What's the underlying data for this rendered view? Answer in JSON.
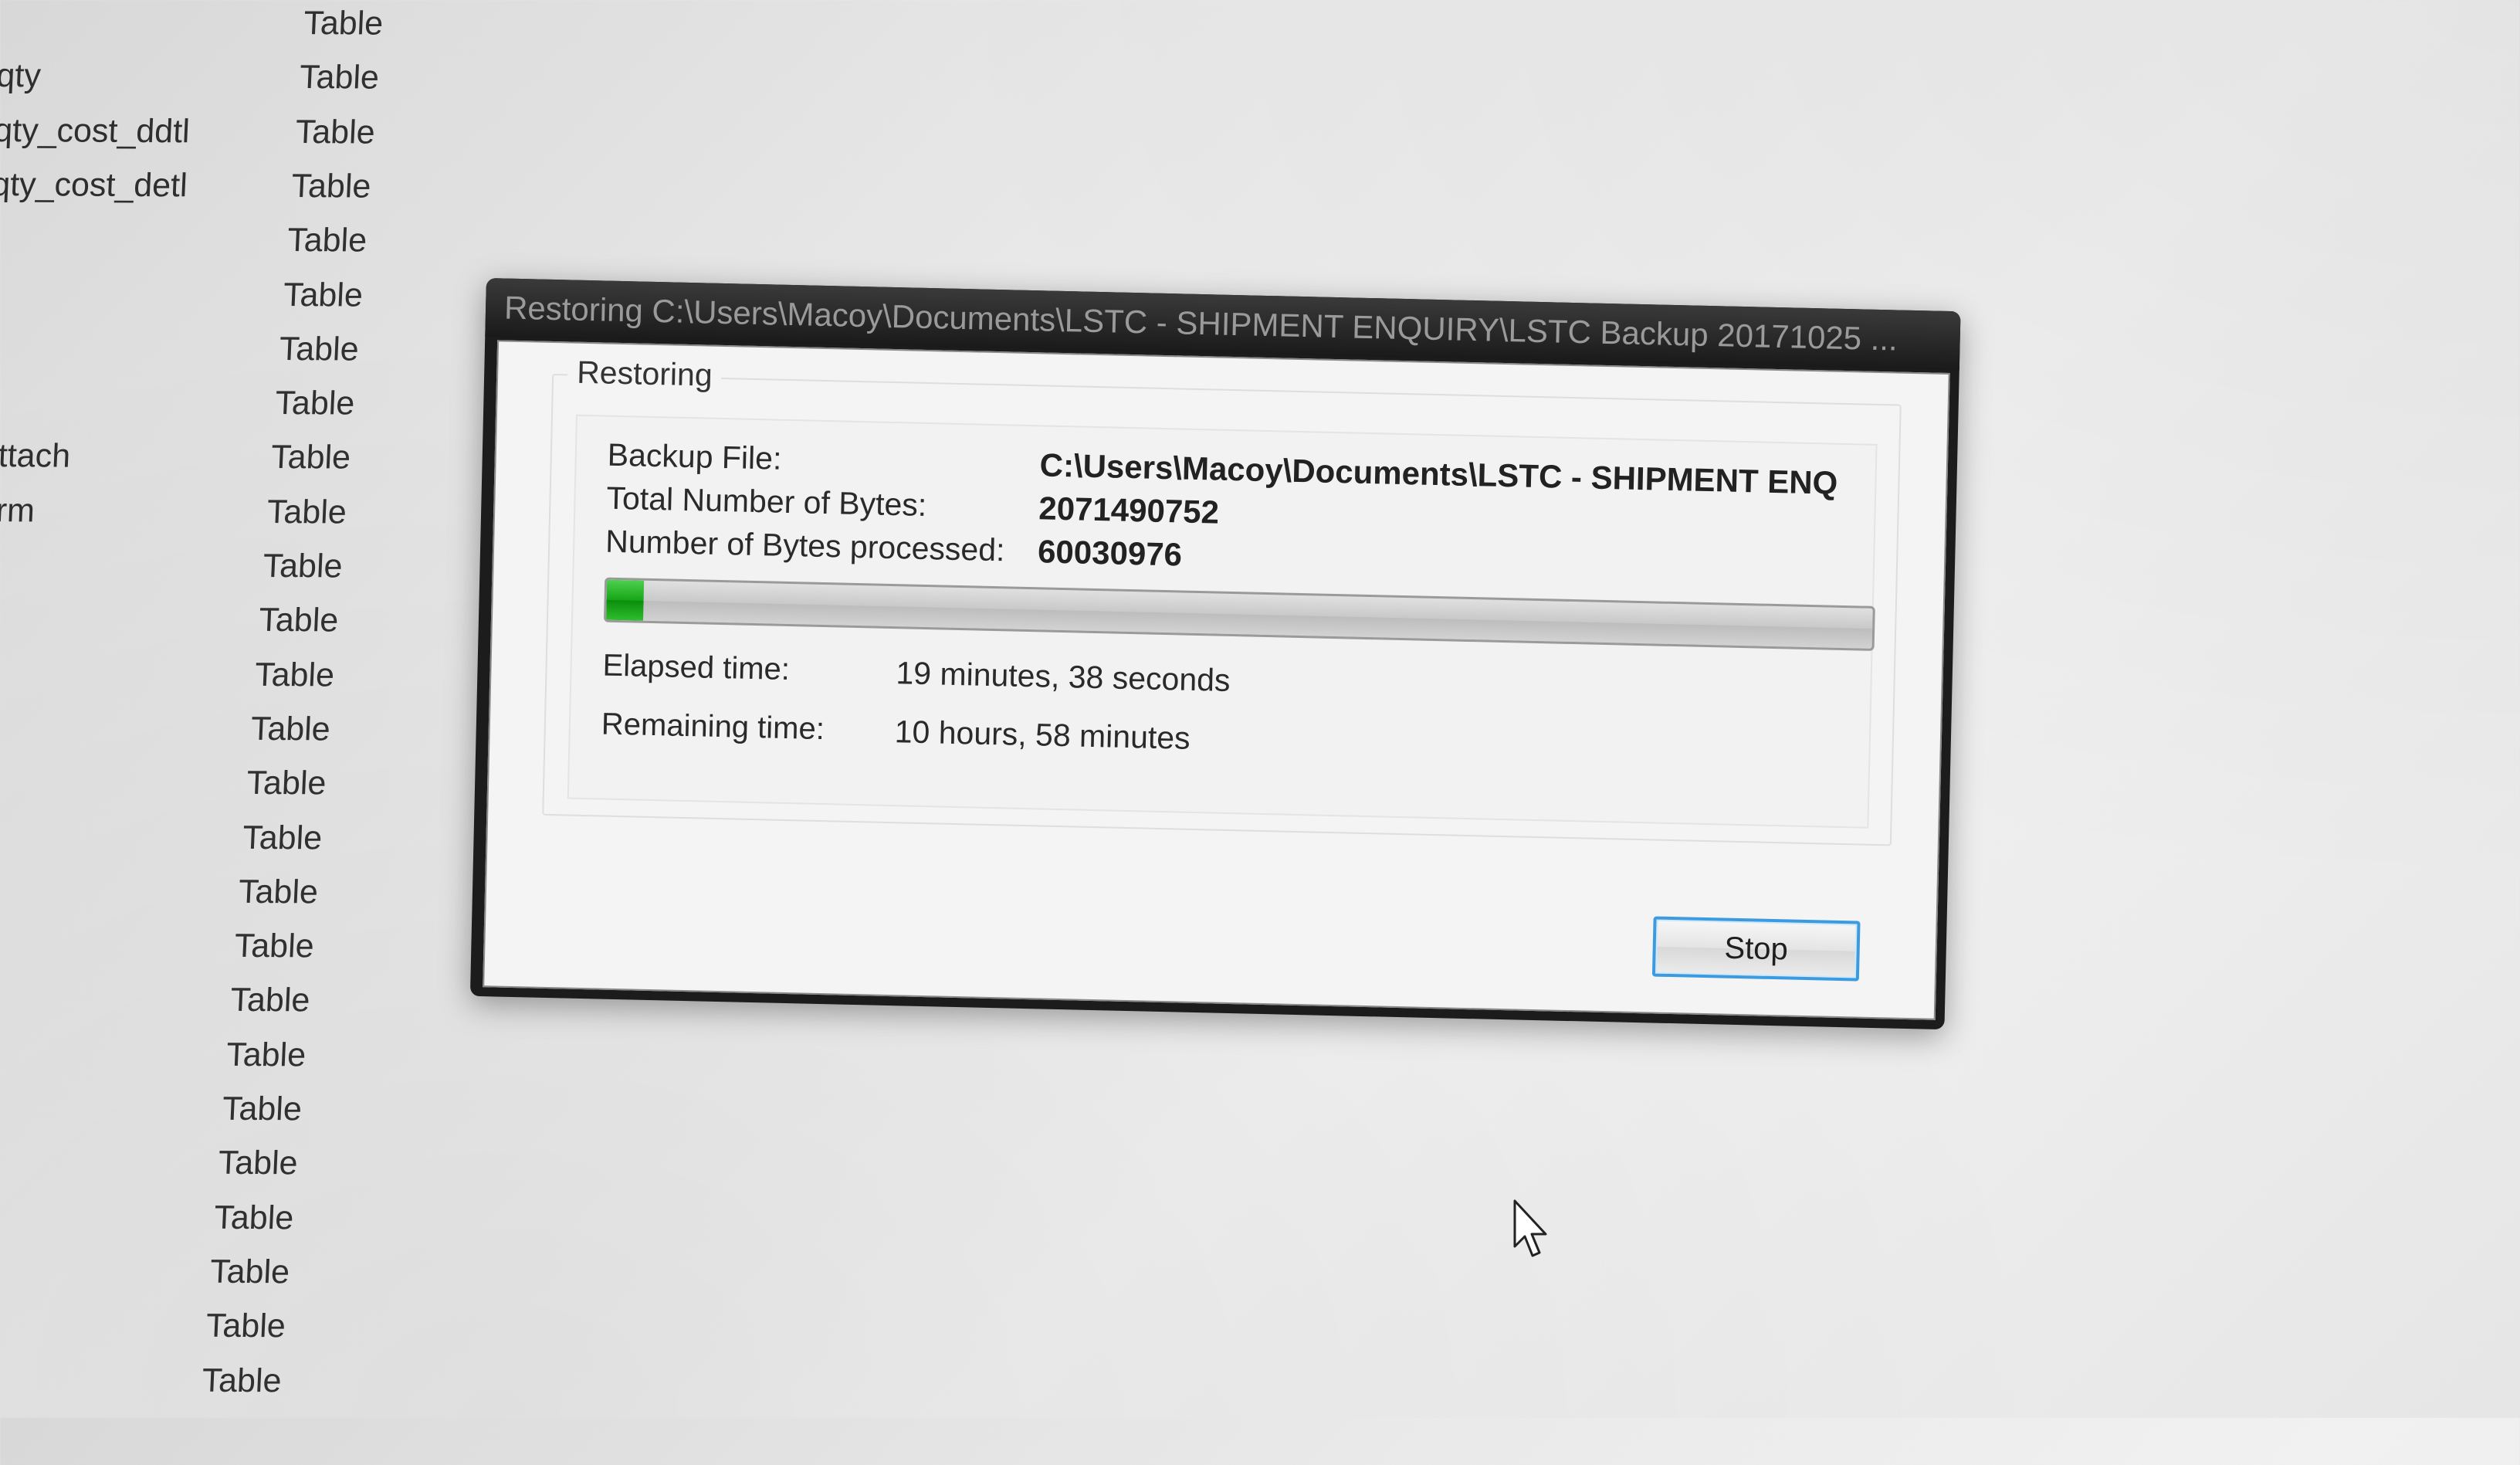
{
  "object_list": {
    "rows": [
      {
        "name": "",
        "type": "Table"
      },
      {
        "name": "qty",
        "type": "Table"
      },
      {
        "name": "qty_cost_ddtl",
        "type": "Table"
      },
      {
        "name": "qty_cost_detl",
        "type": "Table"
      },
      {
        "name": "",
        "type": "Table"
      },
      {
        "name": "",
        "type": "Table"
      },
      {
        "name": "",
        "type": "Table"
      },
      {
        "name": "",
        "type": "Table"
      },
      {
        "name": "attach",
        "type": "Table"
      },
      {
        "name": "orm",
        "type": "Table"
      },
      {
        "name": "",
        "type": "Table"
      },
      {
        "name": "",
        "type": "Table"
      },
      {
        "name": "",
        "type": "Table"
      },
      {
        "name": "",
        "type": "Table"
      },
      {
        "name": "",
        "type": "Table"
      },
      {
        "name": "",
        "type": "Table"
      },
      {
        "name": "",
        "type": "Table"
      },
      {
        "name": "",
        "type": "Table"
      },
      {
        "name": "",
        "type": "Table"
      },
      {
        "name": "",
        "type": "Table"
      },
      {
        "name": "",
        "type": "Table"
      },
      {
        "name": "",
        "type": "Table"
      },
      {
        "name": "",
        "type": "Table"
      },
      {
        "name": "",
        "type": "Table"
      },
      {
        "name": "",
        "type": "Table"
      },
      {
        "name": "",
        "type": "Table"
      }
    ]
  },
  "dialog": {
    "title": "Restoring C:\\Users\\Macoy\\Documents\\LSTC - SHIPMENT ENQUIRY\\LSTC Backup 20171025 ...",
    "group_caption": "Restoring",
    "backup_file_label": "Backup File:",
    "backup_file_value": "C:\\Users\\Macoy\\Documents\\LSTC - SHIPMENT ENQ",
    "total_bytes_label": "Total Number of Bytes:",
    "total_bytes_value": "2071490752",
    "processed_bytes_label": "Number of Bytes processed:",
    "processed_bytes_value": "60030976",
    "progress_fraction": 0.029,
    "elapsed_label": "Elapsed time:",
    "elapsed_value": "19 minutes, 38 seconds",
    "remaining_label": "Remaining time:",
    "remaining_value": "10 hours, 58 minutes",
    "stop_label": "Stop"
  },
  "colors": {
    "progress_fill": "#17a617",
    "button_focus_border": "#3c9be0",
    "title_bar": "#1c1c1c"
  },
  "cursor_icon": "arrow-pointer"
}
